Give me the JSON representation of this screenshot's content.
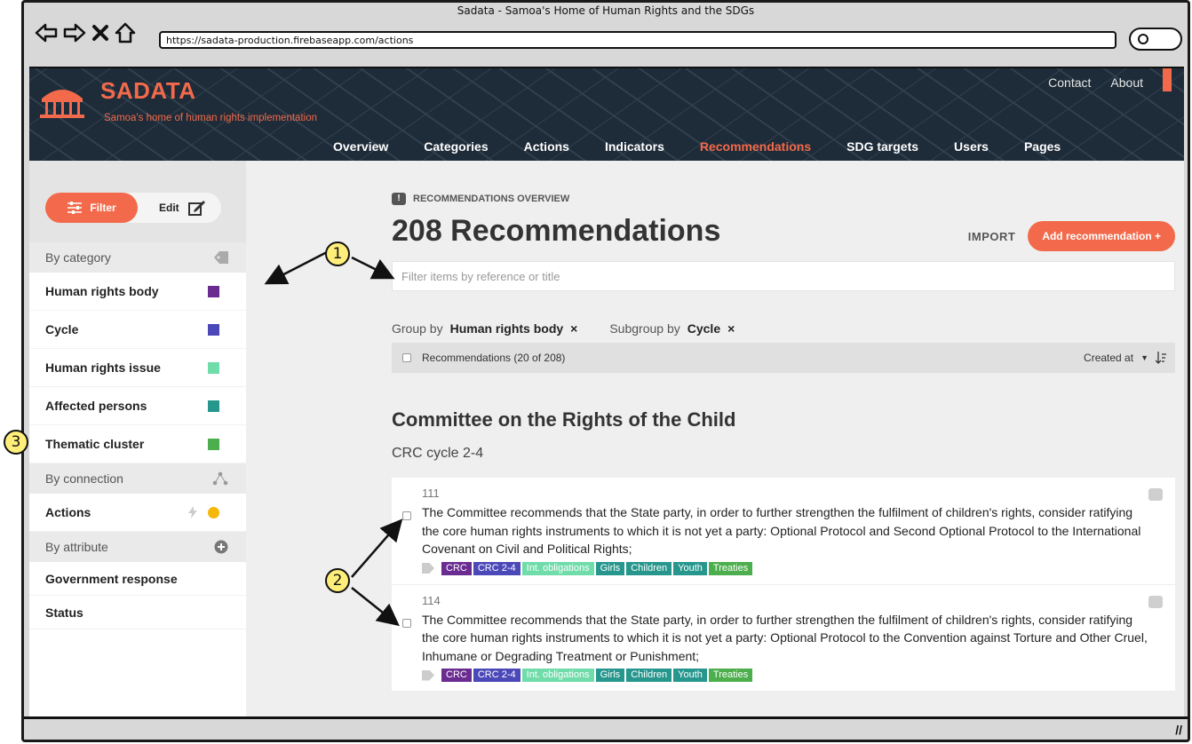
{
  "window": {
    "title": "Sadata - Samoa's Home of Human Rights and the SDGs",
    "url": "https://sadata-production.firebaseapp.com/actions"
  },
  "header": {
    "brand": "SADATA",
    "tagline": "Samoa's home of human rights implementation",
    "toplinks": [
      "Contact",
      "About"
    ],
    "nav": [
      {
        "label": "Overview"
      },
      {
        "label": "Categories"
      },
      {
        "label": "Actions"
      },
      {
        "label": "Indicators"
      },
      {
        "label": "Recommendations",
        "active": true
      },
      {
        "label": "SDG targets"
      },
      {
        "label": "Users"
      },
      {
        "label": "Pages"
      }
    ]
  },
  "sidebar": {
    "filter_label": "Filter",
    "edit_label": "Edit",
    "sections": {
      "category": "By category",
      "connection": "By connection",
      "attribute": "By attribute"
    },
    "categories": [
      {
        "label": "Human rights body",
        "color": "#6a2c91"
      },
      {
        "label": "Cycle",
        "color": "#4b48b8"
      },
      {
        "label": "Human rights issue",
        "color": "#6fdcaa"
      },
      {
        "label": "Affected persons",
        "color": "#27978e"
      },
      {
        "label": "Thematic cluster",
        "color": "#4cae4c"
      }
    ],
    "connections": [
      {
        "label": "Actions",
        "dot_color": "#f5b70a"
      }
    ],
    "attributes": [
      {
        "label": "Government response"
      },
      {
        "label": "Status"
      }
    ]
  },
  "main": {
    "overline": "RECOMMENDATIONS OVERVIEW",
    "title": "208 Recommendations",
    "import_label": "IMPORT",
    "add_label": "Add recommendation +",
    "filter_placeholder": "Filter items by reference or title",
    "group_by_label": "Group by",
    "group_by_value": "Human rights body",
    "subgroup_by_label": "Subgroup by",
    "subgroup_by_value": "Cycle",
    "list_summary": "Recommendations (20 of 208)",
    "sort_label": "Created at",
    "group_title": "Committee on the Rights of the Child",
    "subgroup_title": "CRC cycle 2-4",
    "items": [
      {
        "ref": "111",
        "text": "The Committee recommends that the State party, in order to further strengthen the fulfilment of children's rights, consider ratifying the core human rights instruments to which it is not yet a party: Optional Protocol and Second Optional Protocol to the International Covenant on Civil and Political Rights;",
        "tags": [
          "CRC",
          "CRC 2-4",
          "Int. obligations",
          "Girls",
          "Children",
          "Youth",
          "Treaties"
        ]
      },
      {
        "ref": "114",
        "text": "The Committee recommends that the State party, in order to further strengthen the fulfilment of children's rights, consider ratifying the core human rights instruments to which it is not yet a party: Optional Protocol to the Convention against Torture and Other Cruel, Inhumane or Degrading Treatment or Punishment;",
        "tags": [
          "CRC",
          "CRC 2-4",
          "Int. obligations",
          "Girls",
          "Children",
          "Youth",
          "Treaties"
        ]
      }
    ],
    "tag_colors": [
      "#6a2c91",
      "#4b48b8",
      "#6fdcaa",
      "#27978e",
      "#27978e",
      "#27978e",
      "#4cae4c"
    ]
  },
  "annotations": [
    "1",
    "2",
    "3"
  ]
}
